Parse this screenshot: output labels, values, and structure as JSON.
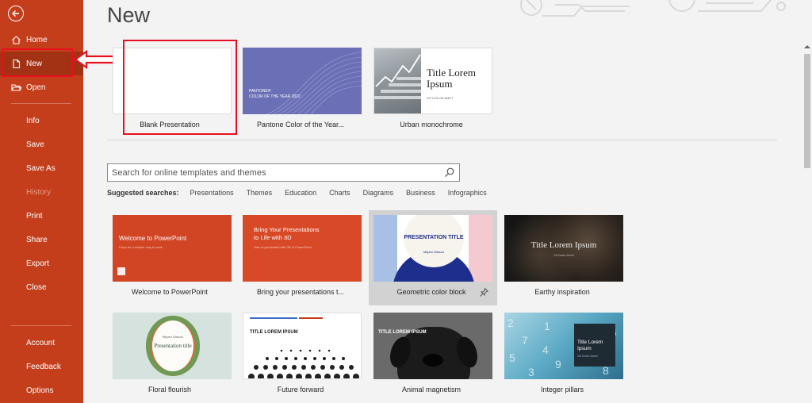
{
  "sidebar": {
    "items": [
      {
        "label": "Home",
        "icon": "home-icon"
      },
      {
        "label": "New",
        "icon": "new-file-icon"
      },
      {
        "label": "Open",
        "icon": "folder-open-icon"
      },
      {
        "label": "Info"
      },
      {
        "label": "Save"
      },
      {
        "label": "Save As"
      },
      {
        "label": "History"
      },
      {
        "label": "Print"
      },
      {
        "label": "Share"
      },
      {
        "label": "Export"
      },
      {
        "label": "Close"
      },
      {
        "label": "Account"
      },
      {
        "label": "Feedback"
      },
      {
        "label": "Options"
      }
    ],
    "color": "#c43e1c"
  },
  "main": {
    "title": "New",
    "featured": [
      {
        "caption": "Blank Presentation"
      },
      {
        "caption": "Pantone Color of the Year...",
        "thumb_text_1": "PANTONE®",
        "thumb_text_2": "COLOR OF THE YEAR 2022"
      },
      {
        "caption": "Urban monochrome",
        "thumb_title": "Title Lorem Ipsum",
        "thumb_sub": "SIT DOLOR AMET"
      }
    ],
    "search": {
      "placeholder": "Search for online templates and themes"
    },
    "suggested": {
      "label": "Suggested searches:",
      "items": [
        "Presentations",
        "Themes",
        "Education",
        "Charts",
        "Diagrams",
        "Business",
        "Infographics"
      ]
    },
    "templates": [
      {
        "caption": "Welcome to PowerPoint",
        "t1": "Welcome to PowerPoint",
        "t2": "5 tips for a simpler way to work"
      },
      {
        "caption": "Bring your presentations t...",
        "t1": "Bring Your Presentations to Life with 3D",
        "t2": "How to get started with 3D in PowerPoint"
      },
      {
        "caption": "Geometric color block",
        "t1": "PRESENTATION TITLE",
        "t2": "Mirjam Nilsson"
      },
      {
        "caption": "Earthy inspiration",
        "t1": "Title Lorem Ipsum",
        "t2": "Sit Dolor Amet"
      },
      {
        "caption": "Floral flourish",
        "t1": "Presentation title",
        "t2": "Mirjam Nilsson"
      },
      {
        "caption": "Future forward",
        "t1": "TITLE LOREM IPSUM"
      },
      {
        "caption": "Animal magnetism",
        "t1": "TITLE LOREM IPSUM"
      },
      {
        "caption": "Integer pillars",
        "t1": "Title Lorem Ipsum",
        "t2": "Sit Dolor Amet"
      }
    ]
  },
  "colors": {
    "accent": "#c43e1c",
    "annotation": "#e8101f"
  }
}
